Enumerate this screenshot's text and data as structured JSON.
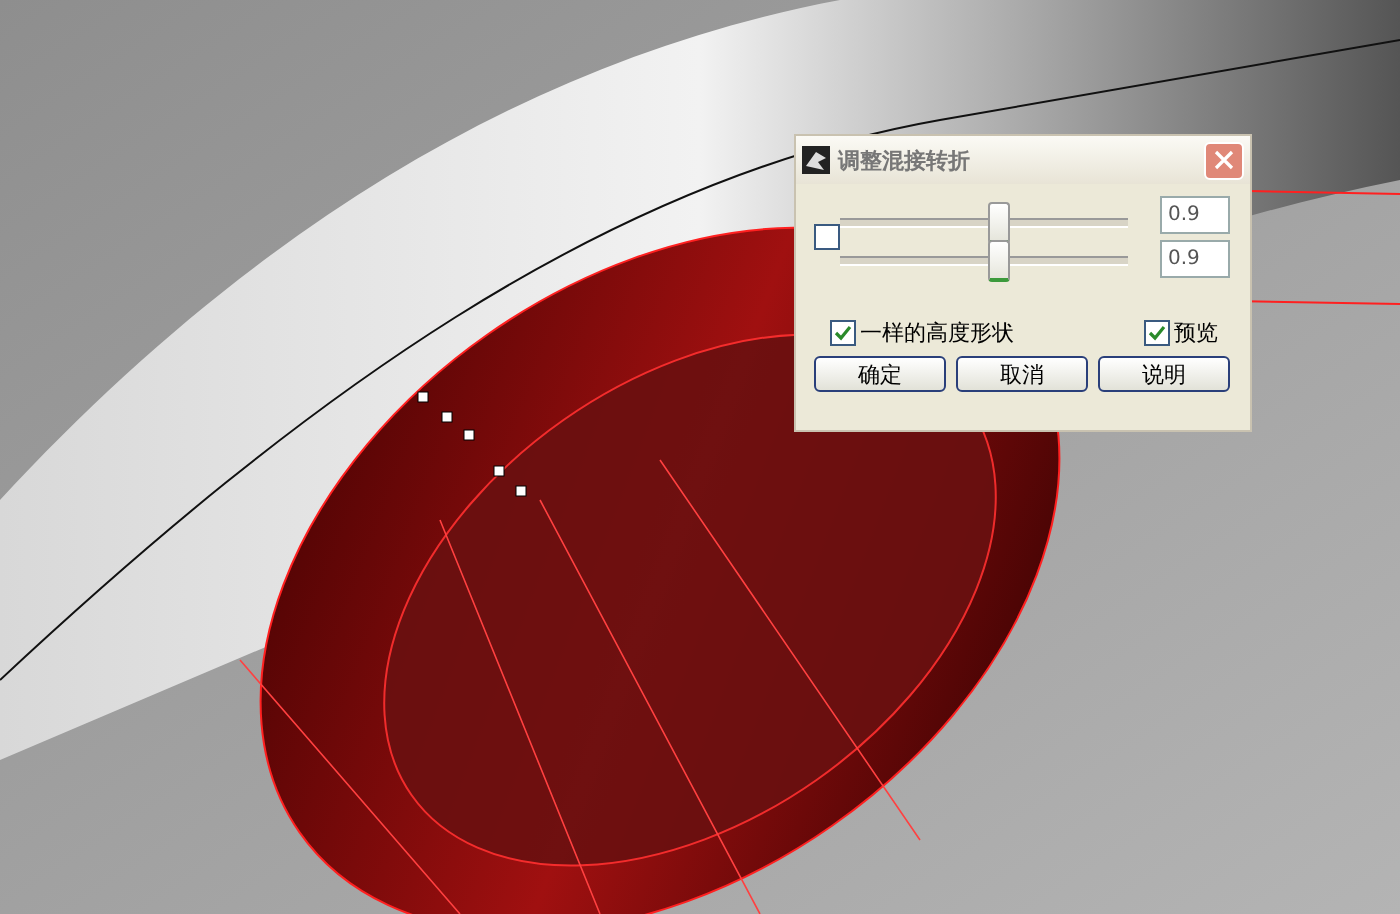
{
  "dialog": {
    "title": "调整混接转折",
    "link_checkbox": {
      "checked": false
    },
    "sliders": [
      {
        "level": 0.55,
        "value": "0.9"
      },
      {
        "level": 0.55,
        "value": "0.9"
      }
    ],
    "options": [
      {
        "label": "一样的高度形状",
        "checked": true
      },
      {
        "label": "预览",
        "checked": true
      }
    ],
    "buttons": [
      "确定",
      "取消",
      "说明"
    ]
  }
}
